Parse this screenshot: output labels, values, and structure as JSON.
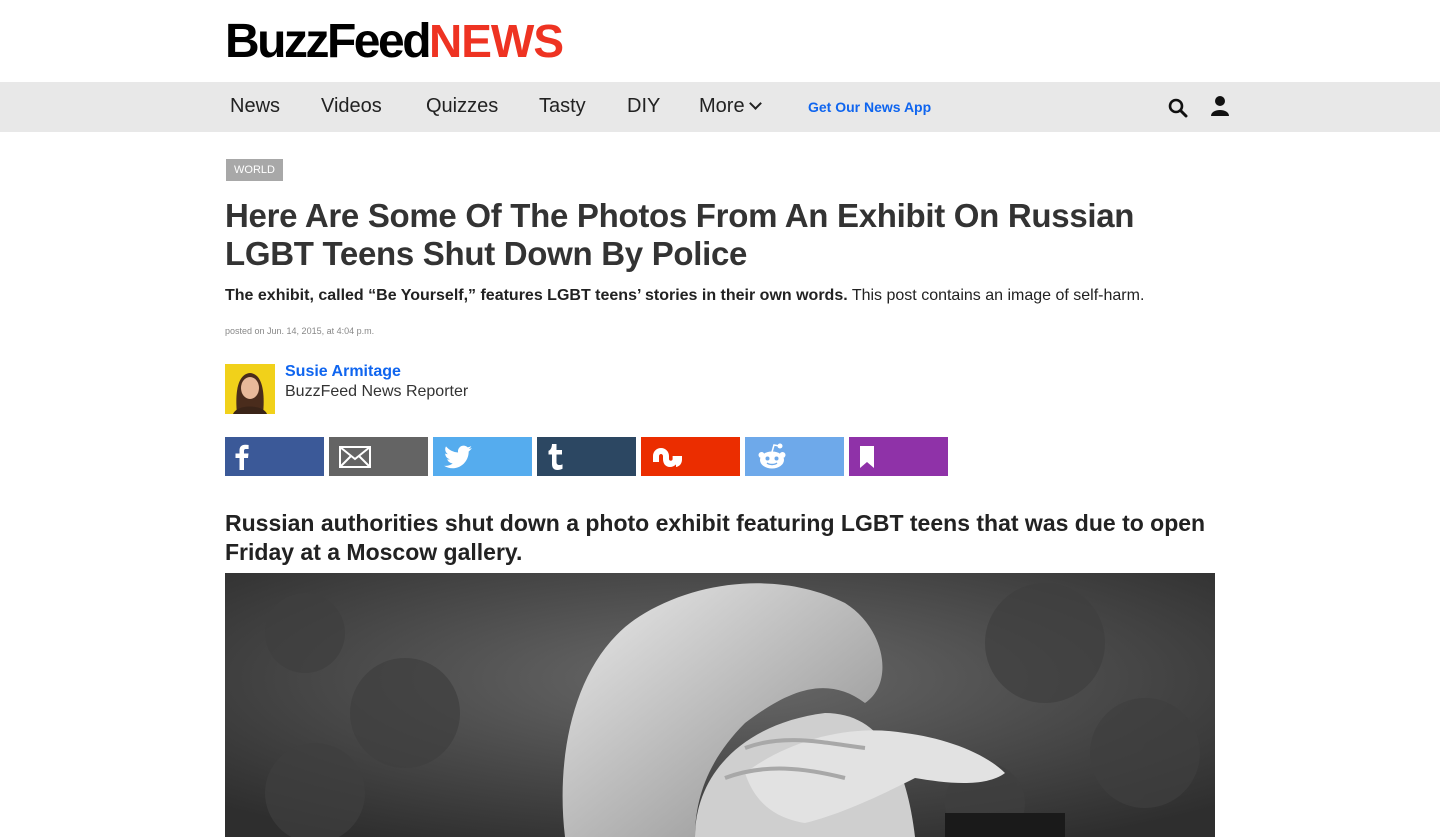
{
  "logo": {
    "part1": "BuzzFeed",
    "part2": "NEWS"
  },
  "nav": {
    "items": [
      {
        "label": "News"
      },
      {
        "label": "Videos"
      },
      {
        "label": "Quizzes"
      },
      {
        "label": "Tasty"
      },
      {
        "label": "DIY"
      },
      {
        "label": "More"
      }
    ],
    "app_link": "Get Our News App"
  },
  "article": {
    "section_tag": "World",
    "title": "Here Are Some Of The Photos From An Exhibit On Russian LGBT Teens Shut Down By Police",
    "dek_bold": "The exhibit, called “Be Yourself,” features LGBT teens’ stories in their own words.",
    "dek_rest": " This post contains an image of self-harm.",
    "posted": "posted on Jun. 14, 2015, at 4:04 p.m.",
    "author": {
      "name": "Susie Armitage",
      "title": "BuzzFeed News Reporter"
    },
    "lede": "Russian authorities shut down a photo exhibit featuring LGBT teens that was due to open Friday at a Moscow gallery."
  },
  "share_buttons": [
    {
      "service": "facebook",
      "icon": "facebook-icon",
      "color": "#3b5998"
    },
    {
      "service": "email",
      "icon": "email-icon",
      "color": "#646464"
    },
    {
      "service": "twitter",
      "icon": "twitter-icon",
      "color": "#55acee"
    },
    {
      "service": "tumblr",
      "icon": "tumblr-icon",
      "color": "#2c4762"
    },
    {
      "service": "stumbleupon",
      "icon": "stumbleupon-icon",
      "color": "#eb2d00"
    },
    {
      "service": "reddit",
      "icon": "reddit-icon",
      "color": "#6ea9ea"
    },
    {
      "service": "bookmark",
      "icon": "bookmark-icon",
      "color": "#8f32a8"
    }
  ],
  "colors": {
    "accent_blue": "#0f65ef",
    "brand_red": "#ee3322",
    "nav_bg": "#e8e8e8"
  }
}
